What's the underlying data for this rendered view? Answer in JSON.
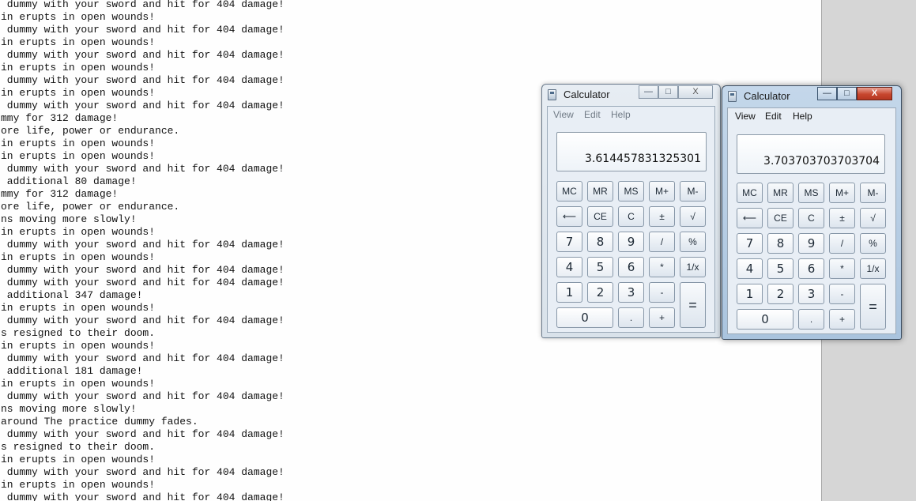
{
  "log": {
    "lines": [
      " dummy with your sword and hit for 404 damage!",
      "in erupts in open wounds!",
      " dummy with your sword and hit for 404 damage!",
      "in erupts in open wounds!",
      " dummy with your sword and hit for 404 damage!",
      "in erupts in open wounds!",
      " dummy with your sword and hit for 404 damage!",
      "in erupts in open wounds!",
      " dummy with your sword and hit for 404 damage!",
      "mmy for 312 damage!",
      "ore life, power or endurance.",
      "in erupts in open wounds!",
      "in erupts in open wounds!",
      " dummy with your sword and hit for 404 damage!",
      " additional 80 damage!",
      "mmy for 312 damage!",
      "ore life, power or endurance.",
      "ns moving more slowly!",
      "in erupts in open wounds!",
      " dummy with your sword and hit for 404 damage!",
      "in erupts in open wounds!",
      " dummy with your sword and hit for 404 damage!",
      " dummy with your sword and hit for 404 damage!",
      " additional 347 damage!",
      "in erupts in open wounds!",
      " dummy with your sword and hit for 404 damage!",
      "s resigned to their doom.",
      "in erupts in open wounds!",
      " dummy with your sword and hit for 404 damage!",
      " additional 181 damage!",
      "in erupts in open wounds!",
      " dummy with your sword and hit for 404 damage!",
      "ns moving more slowly!",
      "around The practice dummy fades.",
      " dummy with your sword and hit for 404 damage!",
      "s resigned to their doom.",
      "in erupts in open wounds!",
      " dummy with your sword and hit for 404 damage!",
      "in erupts in open wounds!",
      " dummy with your sword and hit for 404 damage!"
    ]
  },
  "calc1": {
    "title": "Calculator",
    "menu": [
      "View",
      "Edit",
      "Help"
    ],
    "display": "3.614457831325301"
  },
  "calc2": {
    "title": "Calculator",
    "menu": [
      "View",
      "Edit",
      "Help"
    ],
    "display": "3.703703703703704"
  },
  "window_buttons": {
    "minimize": "—",
    "maximize": "□",
    "close": "X"
  },
  "keys": {
    "mc": "MC",
    "mr": "MR",
    "ms": "MS",
    "mplus": "M+",
    "mminus": "M-",
    "back": "⟵",
    "ce": "CE",
    "c": "C",
    "pm": "±",
    "sqrt": "√",
    "n7": "7",
    "n8": "8",
    "n9": "9",
    "div": "/",
    "pct": "%",
    "n4": "4",
    "n5": "5",
    "n6": "6",
    "mul": "*",
    "inv": "1/x",
    "n1": "1",
    "n2": "2",
    "n3": "3",
    "sub": "-",
    "eq": "=",
    "n0": "0",
    "dot": ".",
    "add": "+"
  },
  "colors": {
    "active_close": "#c7472f",
    "window_frame": "#aac4de"
  }
}
